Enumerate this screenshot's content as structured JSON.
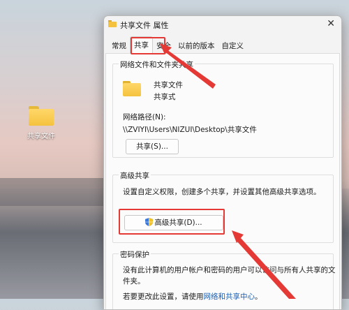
{
  "desktop": {
    "icon_label": "共享文件"
  },
  "dialog": {
    "title": "共享文件 属性",
    "tabs": [
      "常规",
      "共享",
      "安全",
      "以前的版本",
      "自定义"
    ],
    "active_tab": "共享",
    "network_section": {
      "title": "网络文件和文件夹共享",
      "name": "共享文件",
      "type": "共享式",
      "path_label": "网络路径(N):",
      "path_value": "\\\\ZVIYI\\Users\\NIZUI\\Desktop\\共享文件",
      "share_button": "共享(S)..."
    },
    "advanced_section": {
      "title": "高级共享",
      "description": "设置自定义权限，创建多个共享，并设置其他高级共享选项。",
      "advanced_button": "高级共享(D)..."
    },
    "password_section": {
      "title": "密码保护",
      "description_line1": "没有此计算机的用户帐户和密码的用户可以访问与所有人共享的文",
      "description_line2": "件夹。",
      "change_prefix": "若要更改此设置，请使用",
      "change_link": "网络和共享中心",
      "change_suffix": "。"
    }
  },
  "colors": {
    "highlight": "#e53935",
    "link": "#1a5fb4",
    "folder": "#f4c23e"
  }
}
